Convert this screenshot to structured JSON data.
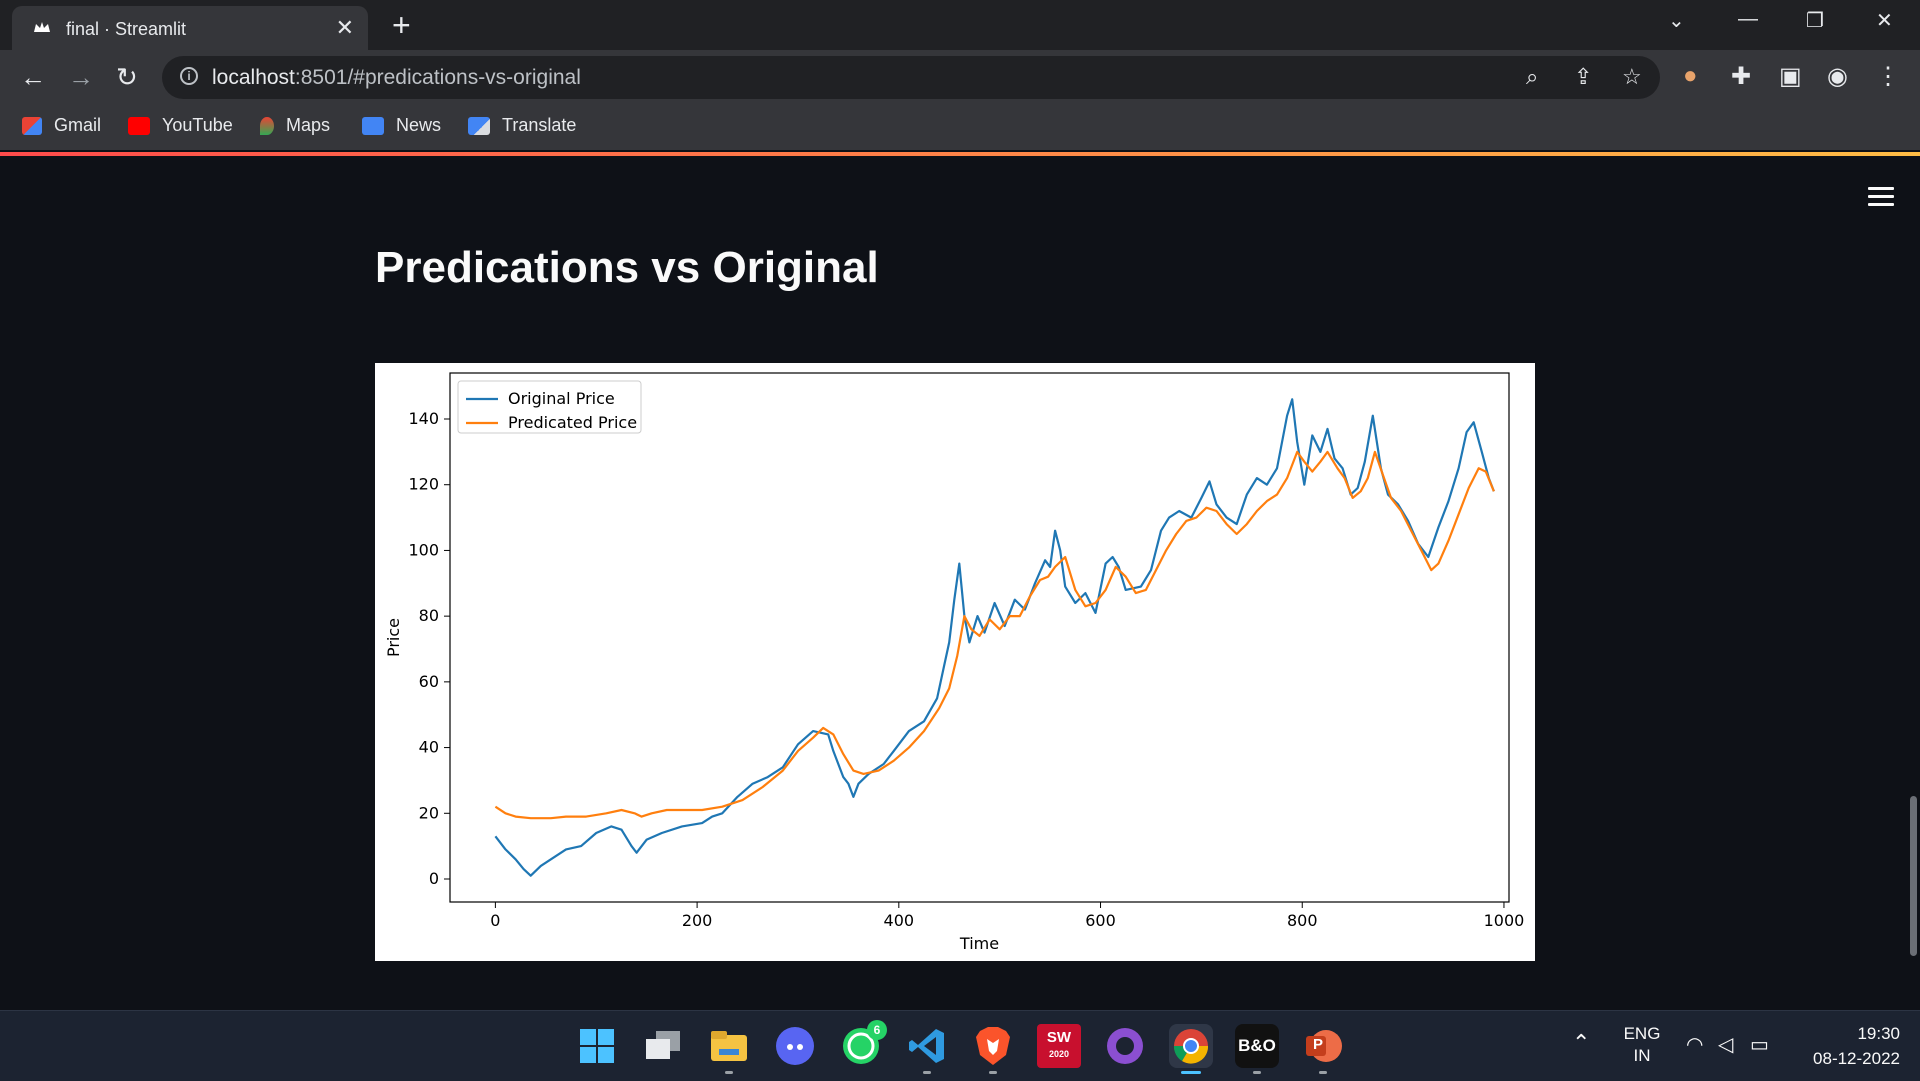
{
  "browser": {
    "tab_title": "final · Streamlit",
    "tab_close": "✕",
    "new_tab": "+",
    "url_host": "localhost",
    "url_rest": ":8501/#predications-vs-original",
    "bookmarks": [
      "Gmail",
      "YouTube",
      "Maps",
      "News",
      "Translate"
    ]
  },
  "page": {
    "title": "Predications vs Original"
  },
  "chart_data": {
    "type": "line",
    "title": "",
    "xlabel": "Time",
    "ylabel": "Price",
    "xlim": [
      -45,
      1005
    ],
    "ylim": [
      -7,
      154
    ],
    "xticks": [
      0,
      200,
      400,
      600,
      800,
      1000
    ],
    "yticks": [
      0,
      20,
      40,
      60,
      80,
      100,
      120,
      140
    ],
    "legend_position": "top-left",
    "series": [
      {
        "name": "Original Price",
        "color": "#1f77b4",
        "points": [
          [
            0,
            13
          ],
          [
            10,
            9
          ],
          [
            20,
            6
          ],
          [
            28,
            3
          ],
          [
            35,
            1
          ],
          [
            45,
            4
          ],
          [
            55,
            6
          ],
          [
            70,
            9
          ],
          [
            85,
            10
          ],
          [
            100,
            14
          ],
          [
            115,
            16
          ],
          [
            125,
            15
          ],
          [
            135,
            10
          ],
          [
            140,
            8
          ],
          [
            150,
            12
          ],
          [
            165,
            14
          ],
          [
            185,
            16
          ],
          [
            205,
            17
          ],
          [
            215,
            19
          ],
          [
            225,
            20
          ],
          [
            240,
            25
          ],
          [
            255,
            29
          ],
          [
            270,
            31
          ],
          [
            285,
            34
          ],
          [
            300,
            41
          ],
          [
            315,
            45
          ],
          [
            330,
            44
          ],
          [
            335,
            39
          ],
          [
            345,
            31
          ],
          [
            350,
            29
          ],
          [
            355,
            25
          ],
          [
            360,
            29
          ],
          [
            370,
            32
          ],
          [
            385,
            35
          ],
          [
            395,
            39
          ],
          [
            410,
            45
          ],
          [
            425,
            48
          ],
          [
            438,
            55
          ],
          [
            445,
            65
          ],
          [
            450,
            72
          ],
          [
            455,
            85
          ],
          [
            460,
            96
          ],
          [
            465,
            80
          ],
          [
            470,
            72
          ],
          [
            478,
            80
          ],
          [
            485,
            75
          ],
          [
            495,
            84
          ],
          [
            505,
            77
          ],
          [
            515,
            85
          ],
          [
            525,
            82
          ],
          [
            535,
            90
          ],
          [
            545,
            97
          ],
          [
            550,
            95
          ],
          [
            555,
            106
          ],
          [
            560,
            100
          ],
          [
            565,
            89
          ],
          [
            575,
            84
          ],
          [
            585,
            87
          ],
          [
            595,
            81
          ],
          [
            605,
            96
          ],
          [
            612,
            98
          ],
          [
            618,
            95
          ],
          [
            625,
            88
          ],
          [
            640,
            89
          ],
          [
            650,
            94
          ],
          [
            660,
            106
          ],
          [
            668,
            110
          ],
          [
            678,
            112
          ],
          [
            690,
            110
          ],
          [
            700,
            116
          ],
          [
            708,
            121
          ],
          [
            715,
            114
          ],
          [
            725,
            110
          ],
          [
            735,
            108
          ],
          [
            745,
            117
          ],
          [
            755,
            122
          ],
          [
            765,
            120
          ],
          [
            775,
            125
          ],
          [
            785,
            141
          ],
          [
            790,
            146
          ],
          [
            795,
            133
          ],
          [
            802,
            120
          ],
          [
            810,
            135
          ],
          [
            818,
            130
          ],
          [
            825,
            137
          ],
          [
            832,
            128
          ],
          [
            840,
            125
          ],
          [
            848,
            117
          ],
          [
            855,
            119
          ],
          [
            862,
            127
          ],
          [
            870,
            141
          ],
          [
            878,
            125
          ],
          [
            885,
            117
          ],
          [
            895,
            114
          ],
          [
            905,
            109
          ],
          [
            915,
            102
          ],
          [
            925,
            98
          ],
          [
            935,
            107
          ],
          [
            945,
            115
          ],
          [
            955,
            125
          ],
          [
            963,
            136
          ],
          [
            970,
            139
          ],
          [
            978,
            130
          ],
          [
            985,
            122
          ],
          [
            990,
            118
          ]
        ]
      },
      {
        "name": "Predicated Price",
        "color": "#ff7f0e",
        "points": [
          [
            0,
            22
          ],
          [
            10,
            20
          ],
          [
            20,
            19
          ],
          [
            35,
            18.5
          ],
          [
            55,
            18.5
          ],
          [
            70,
            19
          ],
          [
            90,
            19
          ],
          [
            110,
            20
          ],
          [
            125,
            21
          ],
          [
            138,
            20
          ],
          [
            145,
            19
          ],
          [
            155,
            20
          ],
          [
            170,
            21
          ],
          [
            185,
            21
          ],
          [
            205,
            21
          ],
          [
            225,
            22
          ],
          [
            245,
            24
          ],
          [
            265,
            28
          ],
          [
            285,
            33
          ],
          [
            300,
            39
          ],
          [
            315,
            43
          ],
          [
            325,
            46
          ],
          [
            335,
            44
          ],
          [
            345,
            38
          ],
          [
            355,
            33
          ],
          [
            365,
            32
          ],
          [
            380,
            33
          ],
          [
            395,
            36
          ],
          [
            410,
            40
          ],
          [
            425,
            45
          ],
          [
            440,
            52
          ],
          [
            450,
            58
          ],
          [
            458,
            68
          ],
          [
            465,
            80
          ],
          [
            472,
            76
          ],
          [
            480,
            74
          ],
          [
            490,
            79
          ],
          [
            500,
            76
          ],
          [
            510,
            80
          ],
          [
            520,
            80
          ],
          [
            530,
            86
          ],
          [
            540,
            91
          ],
          [
            548,
            92
          ],
          [
            555,
            95
          ],
          [
            565,
            98
          ],
          [
            575,
            88
          ],
          [
            585,
            83
          ],
          [
            595,
            84
          ],
          [
            605,
            88
          ],
          [
            615,
            95
          ],
          [
            625,
            92
          ],
          [
            635,
            87
          ],
          [
            645,
            88
          ],
          [
            655,
            94
          ],
          [
            665,
            100
          ],
          [
            675,
            105
          ],
          [
            685,
            109
          ],
          [
            695,
            110
          ],
          [
            705,
            113
          ],
          [
            715,
            112
          ],
          [
            725,
            108
          ],
          [
            735,
            105
          ],
          [
            745,
            108
          ],
          [
            755,
            112
          ],
          [
            765,
            115
          ],
          [
            775,
            117
          ],
          [
            785,
            122
          ],
          [
            795,
            130
          ],
          [
            802,
            127
          ],
          [
            810,
            124
          ],
          [
            818,
            127
          ],
          [
            825,
            130
          ],
          [
            835,
            125
          ],
          [
            842,
            122
          ],
          [
            850,
            116
          ],
          [
            858,
            118
          ],
          [
            865,
            122
          ],
          [
            872,
            130
          ],
          [
            880,
            123
          ],
          [
            888,
            116
          ],
          [
            898,
            112
          ],
          [
            908,
            106
          ],
          [
            918,
            100
          ],
          [
            928,
            94
          ],
          [
            935,
            96
          ],
          [
            945,
            103
          ],
          [
            955,
            111
          ],
          [
            965,
            119
          ],
          [
            975,
            125
          ],
          [
            982,
            124
          ],
          [
            990,
            118
          ]
        ]
      }
    ]
  },
  "taskbar": {
    "apps": [
      "start-icon",
      "task-view-icon",
      "file-explorer-icon",
      "discord-icon",
      "whatsapp-icon",
      "vscode-icon",
      "brave-icon",
      "solidworks-icon",
      "github-desktop-icon",
      "chrome-icon",
      "behance-icon",
      "powerpoint-icon"
    ],
    "whatsapp_badge": "6",
    "solidworks_label": "SW",
    "solidworks_year": "2020",
    "behance_label": "B&O",
    "powerpoint_label": "P",
    "lang_line1": "ENG",
    "lang_line2": "IN",
    "time": "19:30",
    "date": "08-12-2022"
  }
}
